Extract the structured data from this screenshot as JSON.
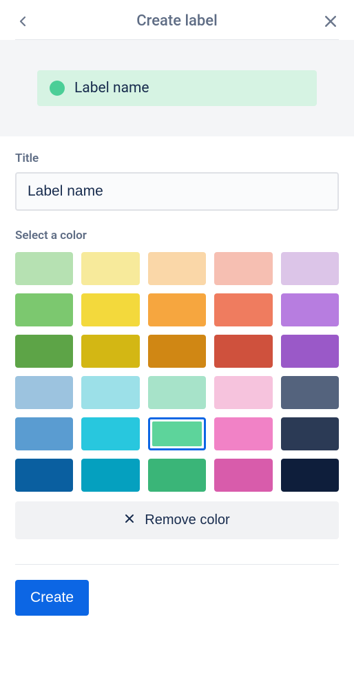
{
  "header": {
    "title": "Create label"
  },
  "preview": {
    "label_text": "Label name",
    "dot_color": "#4BCE97",
    "bg_color": "#D6F3E3"
  },
  "form": {
    "title_label": "Title",
    "title_value": "Label name",
    "color_label": "Select a color",
    "remove_color_label": "Remove color",
    "create_label": "Create"
  },
  "colors": [
    {
      "hex": "#B6E1B2",
      "selected": false
    },
    {
      "hex": "#F7EA9B",
      "selected": false
    },
    {
      "hex": "#FAD7A8",
      "selected": false
    },
    {
      "hex": "#F6BFB2",
      "selected": false
    },
    {
      "hex": "#DCC5E8",
      "selected": false
    },
    {
      "hex": "#7CC86F",
      "selected": false
    },
    {
      "hex": "#F3D93C",
      "selected": false
    },
    {
      "hex": "#F6A63F",
      "selected": false
    },
    {
      "hex": "#EF7C5F",
      "selected": false
    },
    {
      "hex": "#B77DE0",
      "selected": false
    },
    {
      "hex": "#5DA447",
      "selected": false
    },
    {
      "hex": "#D3B714",
      "selected": false
    },
    {
      "hex": "#D08714",
      "selected": false
    },
    {
      "hex": "#CF513D",
      "selected": false
    },
    {
      "hex": "#9A59C8",
      "selected": false
    },
    {
      "hex": "#9CC3DF",
      "selected": false
    },
    {
      "hex": "#9CE0E8",
      "selected": false
    },
    {
      "hex": "#A7E3C9",
      "selected": false
    },
    {
      "hex": "#F6C3DD",
      "selected": false
    },
    {
      "hex": "#54637D",
      "selected": false
    },
    {
      "hex": "#5A9CD1",
      "selected": false
    },
    {
      "hex": "#28C7DE",
      "selected": false
    },
    {
      "hex": "#5DD49B",
      "selected": true
    },
    {
      "hex": "#F182C6",
      "selected": false
    },
    {
      "hex": "#2B3A55",
      "selected": false
    },
    {
      "hex": "#0A5FA0",
      "selected": false
    },
    {
      "hex": "#05A0BF",
      "selected": false
    },
    {
      "hex": "#3AB578",
      "selected": false
    },
    {
      "hex": "#D85CAB",
      "selected": false
    },
    {
      "hex": "#0E1E3B",
      "selected": false
    }
  ]
}
